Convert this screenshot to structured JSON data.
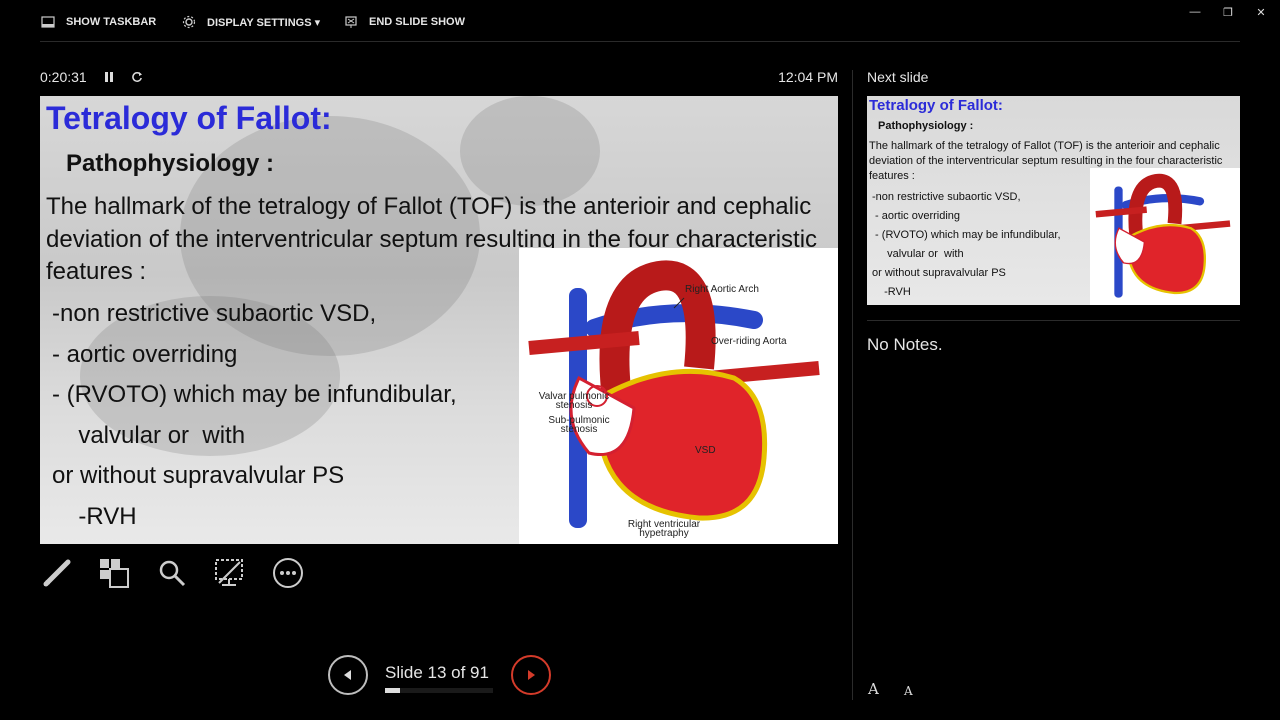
{
  "toolbar": {
    "show_taskbar": "SHOW TASKBAR",
    "display_settings": "DISPLAY SETTINGS ▾",
    "end_slide_show": "END SLIDE SHOW"
  },
  "window_controls": {
    "minimize": "—",
    "restore": "❐",
    "close": "✕"
  },
  "timer": {
    "elapsed": "0:20:31",
    "clock": "12:04 PM"
  },
  "slide": {
    "title": "Tetralogy of Fallot:",
    "subtitle": "Pathophysiology :",
    "body": "The hallmark of the tetralogy of Fallot (TOF) is the anterioir and cephalic deviation of the interventricular septum resulting in the four characteristic features :",
    "bullets": [
      "-non restrictive subaortic VSD,",
      "- aortic overriding",
      "- (RVOTO) which may be infundibular,",
      "  valvular or  with",
      "or without supravalvular PS",
      "  -RVH"
    ],
    "diagram_labels": {
      "right_aortic_arch": "Right Aortic Arch",
      "overriding_aorta": "Over-riding Aorta",
      "valvar_pulmonic": "Valvar pulmonic stenosis",
      "subpulmonic": "Sub-pulmonic stenosis",
      "vsd": "VSD",
      "rvh": "Right ventricular hypetraphy"
    }
  },
  "navigation": {
    "slide_counter": "Slide 13 of 91",
    "progress_fraction": 0.143
  },
  "next_slide": {
    "label": "Next slide",
    "title": "Tetralogy of Fallot:",
    "subtitle": "Pathophysiology :",
    "body": "The hallmark of the tetralogy of Fallot (TOF) is the anterioir and cephalic deviation of the interventricular septum resulting in the four characteristic features :",
    "bullets": [
      "-non restrictive subaortic VSD,",
      " - aortic overriding",
      " - (RVOTO) which may be infundibular,",
      "   valvular or  with",
      "or without supravalvular PS",
      "  -RVH"
    ]
  },
  "notes": {
    "text": "No Notes."
  },
  "font_controls": {
    "increase": "A",
    "decrease": "A"
  },
  "colors": {
    "title_blue": "#2b2bd8",
    "accent_red": "#d43b2a"
  }
}
